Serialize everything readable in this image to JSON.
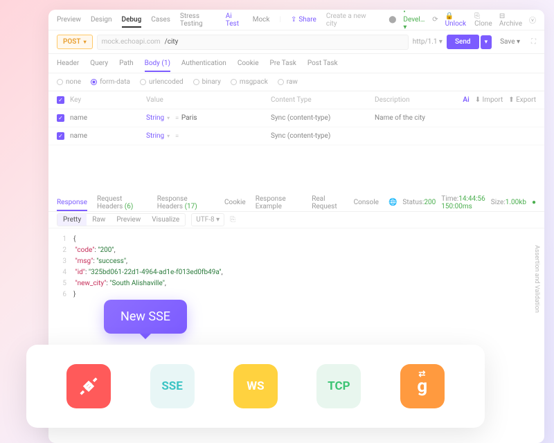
{
  "top_tabs": {
    "items": [
      "Preview",
      "Design",
      "Debug",
      "Cases",
      "Stress Testing",
      "Ai Test",
      "Mock"
    ],
    "active": "Debug",
    "ai_label": "Ai Test",
    "share": "Share",
    "create_placeholder": "Create a new city",
    "devel": "Devel…",
    "unlock": "Unlock",
    "clone": "Clone",
    "archive": "Archive"
  },
  "request": {
    "method": "POST",
    "domain": "mock.echoapi.com",
    "path": "/city",
    "http_ver": "http/1.1",
    "send": "Send",
    "save": "Save"
  },
  "sub_tabs": {
    "items": [
      "Header",
      "Query",
      "Path",
      "Body (1)",
      "Authentication",
      "Cookie",
      "Pre Task",
      "Post Task"
    ],
    "active": "Body (1)"
  },
  "body_types": {
    "items": [
      "none",
      "form-data",
      "urlencoded",
      "binary",
      "msgpack",
      "raw"
    ],
    "active": "form-data"
  },
  "table": {
    "headers": {
      "key": "Key",
      "value": "Value",
      "content_type": "Content Type",
      "description": "Description"
    },
    "toolbar": {
      "ai": "Ai",
      "import": "Import",
      "export": "Export"
    },
    "rows": [
      {
        "key": "name",
        "type": "String",
        "value": "Paris",
        "ct": "Sync (content-type)",
        "desc": "Name of the city"
      },
      {
        "key": "name",
        "type": "String",
        "value": "",
        "ct": "Sync (content-type)",
        "desc": ""
      }
    ]
  },
  "response": {
    "tabs": [
      {
        "l": "Response"
      },
      {
        "l": "Request Headers",
        "c": "(6)"
      },
      {
        "l": "Response Headers",
        "c": "(17)"
      },
      {
        "l": "Cookie"
      },
      {
        "l": "Response Example"
      },
      {
        "l": "Real Request"
      },
      {
        "l": "Console"
      }
    ],
    "active": "Response",
    "status": {
      "label": "Status:",
      "code": "200",
      "time_label": "Time:",
      "time": "14:44:56 150:00ms",
      "size_label": "Size:",
      "size": "1.00kb"
    },
    "views": [
      "Pretty",
      "Raw",
      "Preview",
      "Visualize"
    ],
    "active_view": "Pretty",
    "encoding": "UTF-8",
    "body": {
      "l1": "{",
      "l2k": "\"code\"",
      "l2v": "\"200\"",
      "l3k": "\"msg\"",
      "l3v": "\"success\"",
      "l4k": "\"id\"",
      "l4v": "\"325bd061-22d1-4964-ad1e-f013ed0fb49a\"",
      "l5k": "\"new_city\"",
      "l5v": "\"South Alishaville\"",
      "l6": "}"
    }
  },
  "side_label": "Assertion and Validation",
  "callout": "New SSE",
  "protocols": [
    {
      "id": "http",
      "label": ""
    },
    {
      "id": "sse",
      "label": "SSE"
    },
    {
      "id": "ws",
      "label": "WS"
    },
    {
      "id": "tcp",
      "label": "TCP"
    },
    {
      "id": "grpc",
      "label": "g"
    }
  ]
}
